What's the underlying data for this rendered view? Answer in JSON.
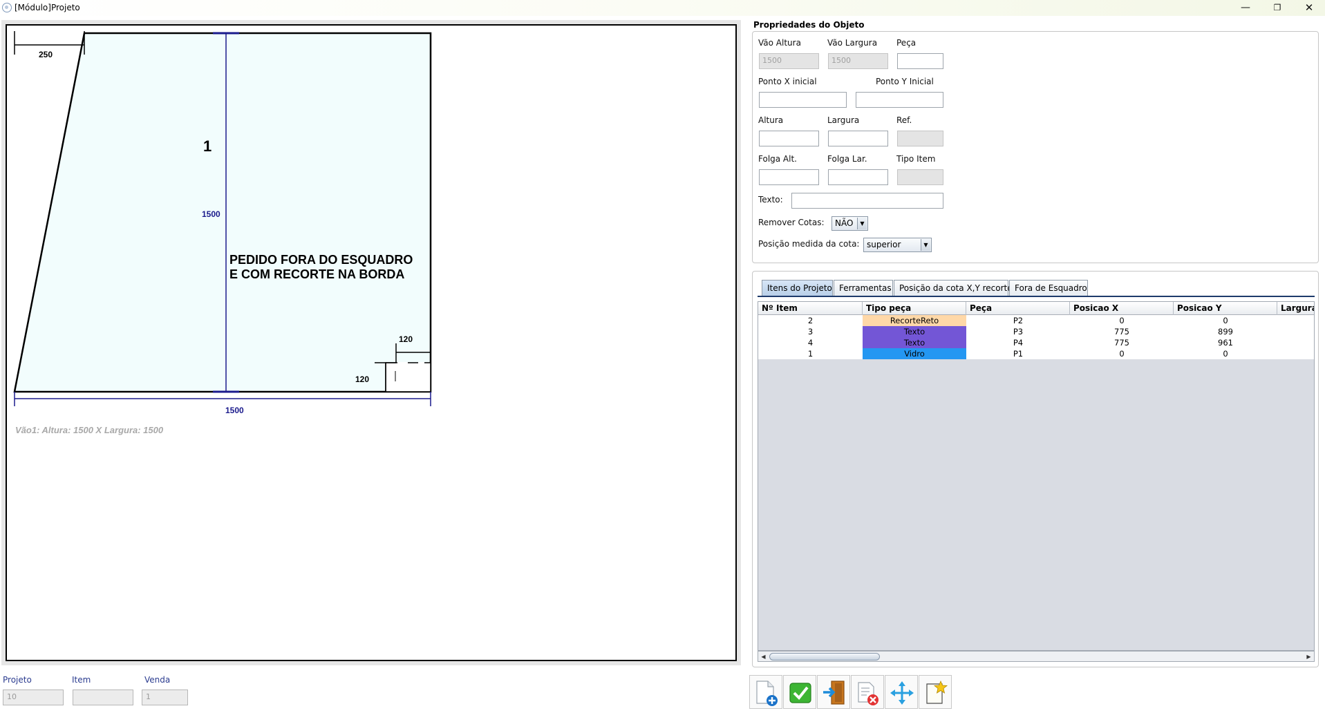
{
  "window": {
    "title": "[Módulo]Projeto",
    "controls": {
      "minimize": "—",
      "maximize": "❐",
      "close": "✕"
    }
  },
  "drawing": {
    "cota_top_left": "250",
    "piece_number": "1",
    "cota_height": "1500",
    "note_line1": "PEDIDO FORA DO ESQUADRO",
    "note_line2": "E COM RECORTE NA BORDA",
    "cota_cut_w": "120",
    "cota_cut_h": "120",
    "cota_width": "1500",
    "vao_info": "Vão1: Altura: 1500 X  Largura: 1500",
    "colors": {
      "glass_fill": "#f2fdfd",
      "dimension_blue": "#1a1a8c",
      "info_gray": "#a8a8a8"
    }
  },
  "footer": {
    "projeto_label": "Projeto",
    "projeto_value": "10",
    "item_label": "Item",
    "item_value": "",
    "venda_label": "Venda",
    "venda_value": "1"
  },
  "props": {
    "title": "Propriedades do Objeto",
    "vao_altura_label": "Vão Altura",
    "vao_altura_value": "1500",
    "vao_largura_label": "Vão Largura",
    "vao_largura_value": "1500",
    "peca_label": "Peça",
    "peca_value": "",
    "ponto_x_label": "Ponto X inicial",
    "ponto_x_value": "",
    "ponto_y_label": "Ponto Y Inicial",
    "ponto_y_value": "",
    "altura_label": "Altura",
    "largura_label": "Largura",
    "ref_label": "Ref.",
    "folga_alt_label": "Folga Alt.",
    "folga_lar_label": "Folga Lar.",
    "tipo_item_label": "Tipo Item",
    "texto_label": "Texto:",
    "remover_cotas_label": "Remover Cotas:",
    "remover_cotas_value": "NÃO",
    "posicao_cota_label": "Posição medida da cota:",
    "posicao_cota_value": "superior"
  },
  "tabs": [
    {
      "label": "Itens do Projeto",
      "active": true
    },
    {
      "label": "Ferramentas"
    },
    {
      "label": "Posição da cota X,Y recorte"
    },
    {
      "label": "Fora de Esquadro"
    }
  ],
  "table": {
    "columns": [
      "Nº Item",
      "Tipo peça",
      "Peça",
      "Posicao X",
      "Posicao Y",
      "Largura"
    ],
    "rows": [
      {
        "item": "2",
        "tipo": "RecorteReto",
        "peca": "P2",
        "x": "0",
        "y": "0",
        "color": "#ffd8a8"
      },
      {
        "item": "3",
        "tipo": "Texto",
        "peca": "P3",
        "x": "775",
        "y": "899",
        "color": "#7356d6"
      },
      {
        "item": "4",
        "tipo": "Texto",
        "peca": "P4",
        "x": "775",
        "y": "961",
        "color": "#7356d6"
      },
      {
        "item": "1",
        "tipo": "Vidro",
        "peca": "P1",
        "x": "0",
        "y": "0",
        "color": "#2497f2"
      }
    ]
  },
  "toolbar": {
    "icons": [
      "new-document-icon",
      "confirm-check-icon",
      "exit-door-icon",
      "delete-document-icon",
      "move-arrows-icon",
      "favorite-note-icon"
    ]
  }
}
